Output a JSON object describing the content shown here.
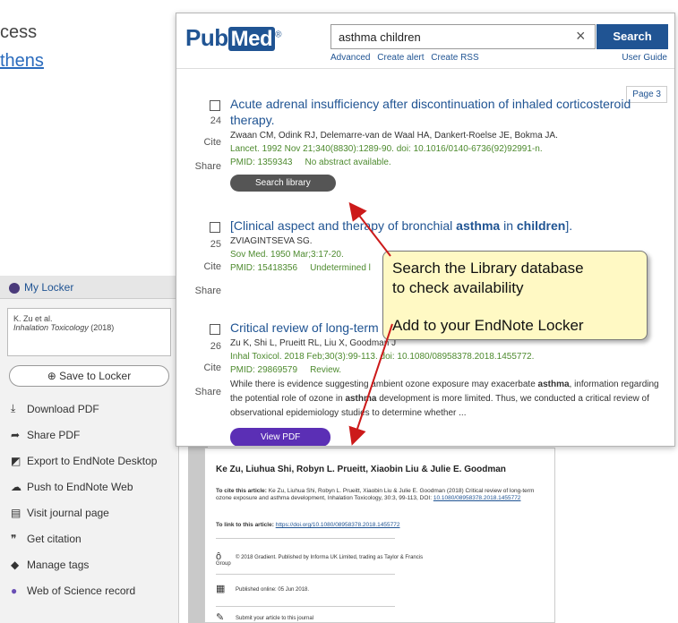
{
  "background_text": {
    "line1": "cess",
    "line2_link": "thens"
  },
  "pubmed": {
    "logo_prefix": "Pub",
    "logo_box": "Med",
    "logo_reg": "®",
    "search_value": "asthma children",
    "clear_glyph": "×",
    "search_button": "Search",
    "links": [
      "Advanced",
      "Create alert",
      "Create RSS"
    ],
    "user_guide": "User Guide",
    "page_tag": "Page 3",
    "articles": [
      {
        "num": "24",
        "title": "Acute adrenal insufficiency after discontinuation of inhaled corticosteroid therapy.",
        "authors": "Zwaan CM, Odink RJ, Delemarre-van de Waal HA, Dankert-Roelse JE, Bokma JA.",
        "journal": "Lancet. 1992 Nov 21;340(8830):1289-90. doi: 10.1016/0140-6736(92)92991-n.",
        "pmid": "PMID: 1359343",
        "pmid_extra": "No abstract available.",
        "button": "Search library"
      },
      {
        "num": "25",
        "title_pre": "[Clinical aspect and therapy of bronchial ",
        "title_b1": "asthma",
        "title_mid": " in ",
        "title_b2": "children",
        "title_post": "].",
        "authors": "ZVIAGINTSEVA SG.",
        "journal": "Sov Med. 1950 Mar;3:17-20.",
        "pmid": "PMID: 15418356",
        "pmid_extra": "Undetermined l"
      },
      {
        "num": "26",
        "title": "Critical review of long-term o",
        "authors": "Zu K, Shi L, Prueitt RL, Liu X, Goodman J",
        "journal": "Inhal Toxicol. 2018 Feb;30(3):99-113. doi: 10.1080/08958378.2018.1455772.",
        "pmid": "PMID: 29869579",
        "pmid_extra": "Review.",
        "abstract_1": "While there is evidence suggesting ambient ozone exposure may exacerbate ",
        "abstract_b1": "asthma",
        "abstract_2": ", information regarding the potential role of ozone in ",
        "abstract_b2": "asthma",
        "abstract_3": " development is more limited. Thus, we conducted a critical review of observational epidemiology studies to determine whether ...",
        "button": "View PDF"
      }
    ],
    "side_labels": {
      "cite": "Cite",
      "share": "Share"
    }
  },
  "callout": {
    "line1": "Search the Library database",
    "line2": "to check availability",
    "line3": "Add to your EndNote Locker"
  },
  "sidebar": {
    "header": "My Locker",
    "card_authors": "K. Zu et al.",
    "card_journal": "Inhalation Toxicology",
    "card_year": "(2018)",
    "save_button": "Save to Locker",
    "menu": [
      {
        "label": "Download PDF",
        "icon": "download-icon"
      },
      {
        "label": "Share PDF",
        "icon": "share-icon"
      },
      {
        "label": "Export to EndNote Desktop",
        "icon": "export-icon"
      },
      {
        "label": "Push to EndNote Web",
        "icon": "cloud-icon"
      },
      {
        "label": "Visit journal page",
        "icon": "journal-icon"
      },
      {
        "label": "Get citation",
        "icon": "quote-icon"
      },
      {
        "label": "Manage tags",
        "icon": "tag-icon"
      },
      {
        "label": "Web of Science record",
        "icon": "wos-icon"
      }
    ]
  },
  "document": {
    "authors": "Ke Zu, Liuhua Shi, Robyn L. Prueitt, Xiaobin Liu & Julie E. Goodman",
    "cite_label": "To cite this article:",
    "cite_text": " Ke Zu, Liuhua Shi, Robyn L. Prueitt, Xiaobin Liu & Julie E. Goodman (2018) Critical review of long-term ozone exposure and asthma development, Inhalation Toxicology, 30:3, 99-113, DOI: ",
    "cite_doi": "10.1080/08958378.2018.1455772",
    "link_label": "To link to this article: ",
    "link_url": "https://doi.org/10.1080/08958378.2018.1455772",
    "copyright": "© 2018 Gradient. Published by Informa UK Limited, trading as Taylor & Francis Group",
    "published": "Published online: 05 Jun 2018.",
    "submit": "Submit your article to this journal"
  }
}
